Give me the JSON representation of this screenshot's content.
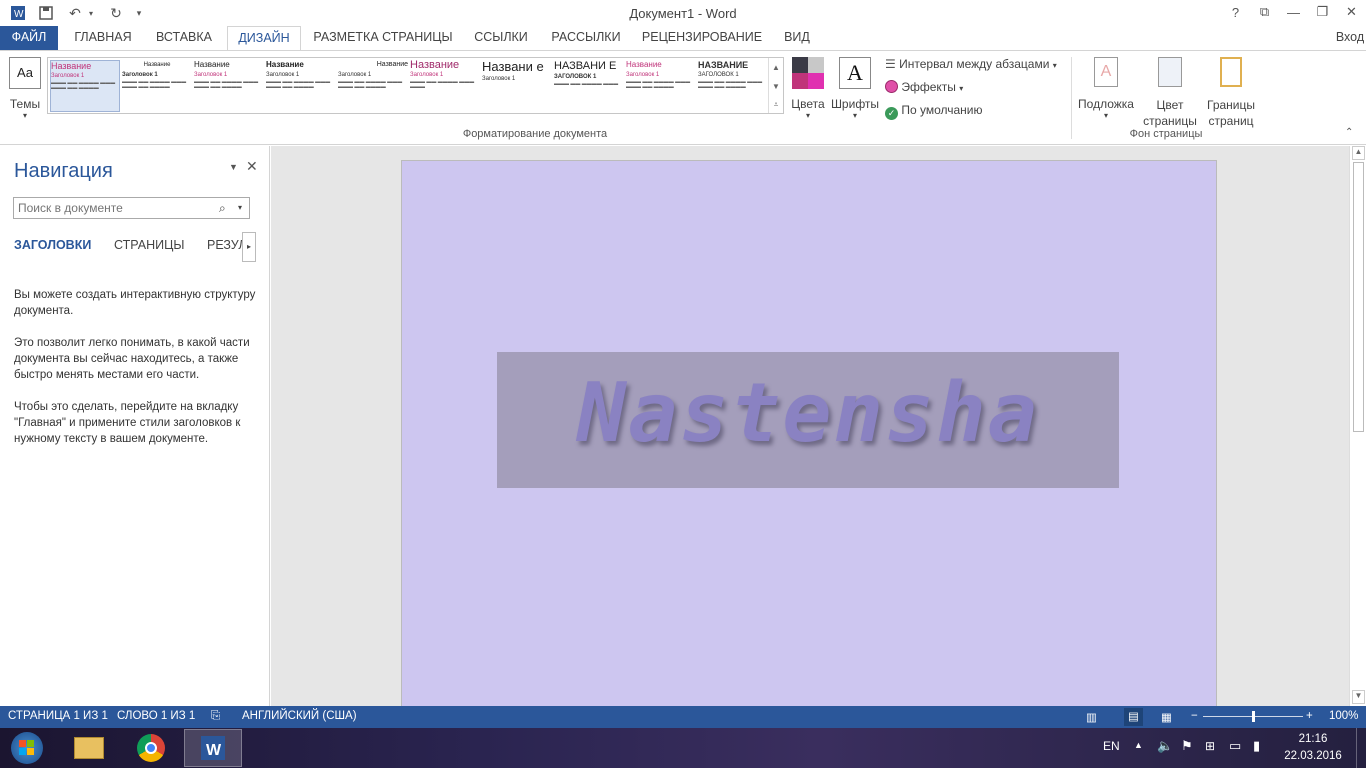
{
  "window": {
    "title": "Документ1 - Word",
    "login": "Вход"
  },
  "tabs": [
    "ФАЙЛ",
    "ГЛАВНАЯ",
    "ВСТАВКА",
    "ДИЗАЙН",
    "РАЗМЕТКА СТРАНИЦЫ",
    "ССЫЛКИ",
    "РАССЫЛКИ",
    "РЕЦЕНЗИРОВАНИЕ",
    "ВИД"
  ],
  "active_tab": "ДИЗАЙН",
  "ribbon": {
    "themes_label": "Темы",
    "gallery": [
      {
        "h": "Название",
        "s": "Заголовок 1"
      },
      {
        "h": "Название",
        "s": "Заголовок 1"
      },
      {
        "h": "Название",
        "s": "Заголовок 1"
      },
      {
        "h": "Название",
        "s": "Заголовок 1"
      },
      {
        "h": "Название",
        "s": "Заголовок 1"
      },
      {
        "h": "Название",
        "s": "Заголовок 1"
      },
      {
        "h": "Названи е",
        "s": "Заголовок 1"
      },
      {
        "h": "НАЗВАНИ Е",
        "s": "ЗАГОЛОВОК 1"
      },
      {
        "h": "Название",
        "s": "Заголовок 1"
      },
      {
        "h": "НАЗВАНИЕ",
        "s": "ЗАГОЛОВОК 1"
      }
    ],
    "colors_label": "Цвета",
    "fonts_label": "Шрифты",
    "paragraph_spacing": "Интервал между абзацами",
    "effects": "Эффекты",
    "default": "По умолчанию",
    "group_format": "Форматирование документа",
    "watermark": "Подложка",
    "page_color": "Цвет страницы",
    "page_borders": "Границы страниц",
    "group_background": "Фон страницы"
  },
  "nav": {
    "title": "Навигация",
    "search_placeholder": "Поиск в документе",
    "tabs": [
      "ЗАГОЛОВКИ",
      "СТРАНИЦЫ",
      "РЕЗУЛ"
    ],
    "p1": "Вы можете создать интерактивную структуру документа.",
    "p2": "Это позволит легко понимать, в какой части документа вы сейчас находитесь, а также быстро менять местами его части.",
    "p3": "Чтобы это сделать, перейдите на вкладку \"Главная\" и примените стили заголовков к нужному тексту в вашем документе."
  },
  "document": {
    "wordart": "Nastensha"
  },
  "status": {
    "page": "СТРАНИЦА 1 ИЗ 1",
    "words": "СЛОВО 1 ИЗ 1",
    "lang": "АНГЛИЙСКИЙ (США)",
    "zoom": "100%",
    "zoom_level": 1.0
  },
  "taskbar": {
    "lang": "EN",
    "time": "21:16",
    "date": "22.03.2016"
  },
  "colors": {
    "accent": "#2b579a",
    "page": "#cdc6f0",
    "wordart_box": "#a49ebb",
    "wordart_text": "#8a82c2"
  }
}
